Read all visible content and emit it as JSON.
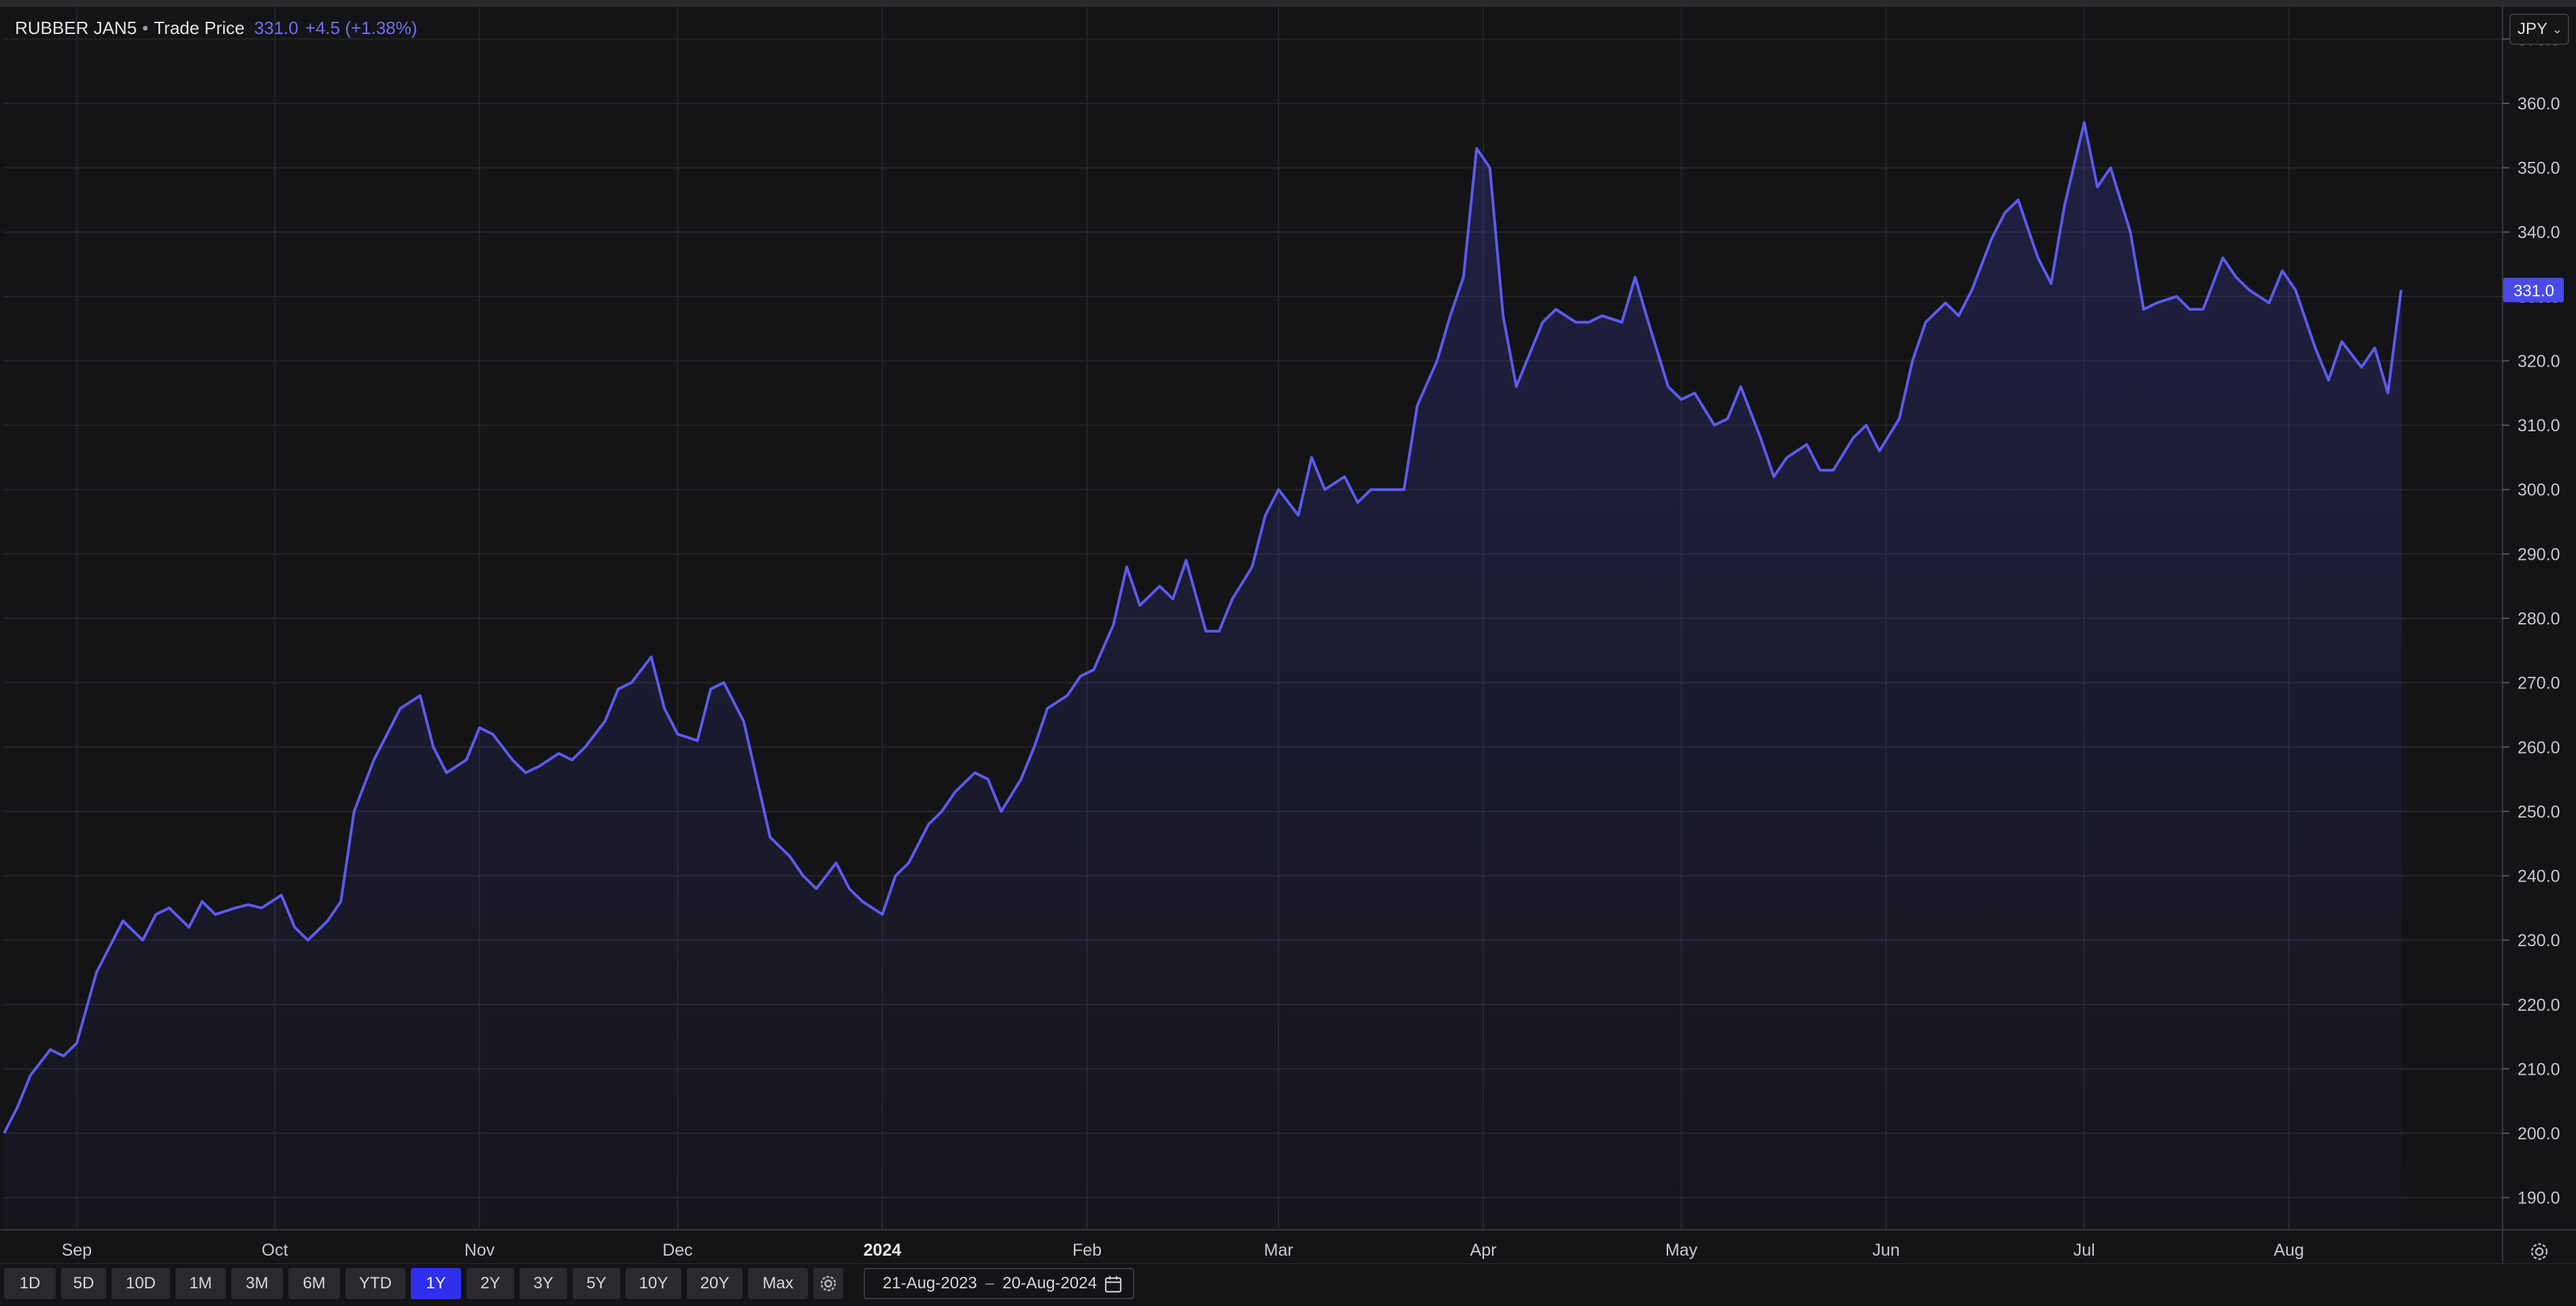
{
  "legend": {
    "symbol": "RUBBER JAN5",
    "separator": "•",
    "series_label": "Trade Price",
    "last_value": "331.0",
    "change": "+4.5 (+1.38%)"
  },
  "currency": {
    "label": "JPY",
    "chevron_icon": "chevron-down-icon"
  },
  "price_tag": "331.0",
  "toolbar": {
    "ranges": [
      "1D",
      "5D",
      "10D",
      "1M",
      "3M",
      "6M",
      "YTD",
      "1Y",
      "2Y",
      "3Y",
      "5Y",
      "10Y",
      "20Y",
      "Max"
    ],
    "active_range": "1Y",
    "settings_icon": "gear-icon",
    "date_from": "21-Aug-2023",
    "date_sep": "–",
    "date_to": "20-Aug-2024",
    "calendar_icon": "calendar-icon"
  },
  "corner_icon": "gear-icon",
  "colors": {
    "line": "#5b5bf0",
    "active_button": "#2f2ff0",
    "background": "#141416",
    "grid": "#242428"
  },
  "chart_data": {
    "type": "area",
    "title": "",
    "xlabel": "",
    "ylabel": "",
    "ylim": [
      185,
      375
    ],
    "y_ticks": [
      "190.0",
      "200.0",
      "210.0",
      "220.0",
      "230.0",
      "240.0",
      "250.0",
      "260.0",
      "270.0",
      "280.0",
      "290.0",
      "300.0",
      "310.0",
      "320.0",
      "330.0",
      "340.0",
      "350.0",
      "360.0",
      "370.0"
    ],
    "x_ticks": [
      {
        "label": "Sep",
        "date": "2023-09-01",
        "bold": false
      },
      {
        "label": "Oct",
        "date": "2023-10-01",
        "bold": false
      },
      {
        "label": "Nov",
        "date": "2023-11-01",
        "bold": false
      },
      {
        "label": "Dec",
        "date": "2023-12-01",
        "bold": false
      },
      {
        "label": "2024",
        "date": "2024-01-01",
        "bold": true
      },
      {
        "label": "Feb",
        "date": "2024-02-01",
        "bold": false
      },
      {
        "label": "Mar",
        "date": "2024-03-01",
        "bold": false
      },
      {
        "label": "Apr",
        "date": "2024-04-01",
        "bold": false
      },
      {
        "label": "May",
        "date": "2024-05-01",
        "bold": false
      },
      {
        "label": "Jun",
        "date": "2024-06-01",
        "bold": false
      },
      {
        "label": "Jul",
        "date": "2024-07-01",
        "bold": false
      },
      {
        "label": "Aug",
        "date": "2024-08-01",
        "bold": false
      }
    ],
    "grid": true,
    "series": [
      {
        "points": [
          [
            "2023-08-21",
            200.0
          ],
          [
            "2023-08-23",
            204.0
          ],
          [
            "2023-08-25",
            209.0
          ],
          [
            "2023-08-28",
            213.0
          ],
          [
            "2023-08-30",
            212.0
          ],
          [
            "2023-09-01",
            214.0
          ],
          [
            "2023-09-04",
            225.0
          ],
          [
            "2023-09-06",
            229.0
          ],
          [
            "2023-09-08",
            233.0
          ],
          [
            "2023-09-11",
            230.0
          ],
          [
            "2023-09-13",
            234.0
          ],
          [
            "2023-09-15",
            235.0
          ],
          [
            "2023-09-18",
            232.0
          ],
          [
            "2023-09-20",
            236.0
          ],
          [
            "2023-09-22",
            234.0
          ],
          [
            "2023-09-25",
            235.0
          ],
          [
            "2023-09-27",
            235.5
          ],
          [
            "2023-09-29",
            235.0
          ],
          [
            "2023-10-02",
            237.0
          ],
          [
            "2023-10-04",
            232.0
          ],
          [
            "2023-10-06",
            230.0
          ],
          [
            "2023-10-09",
            233.0
          ],
          [
            "2023-10-11",
            236.0
          ],
          [
            "2023-10-13",
            250.0
          ],
          [
            "2023-10-16",
            258.0
          ],
          [
            "2023-10-18",
            262.0
          ],
          [
            "2023-10-20",
            266.0
          ],
          [
            "2023-10-23",
            268.0
          ],
          [
            "2023-10-25",
            260.0
          ],
          [
            "2023-10-27",
            256.0
          ],
          [
            "2023-10-30",
            258.0
          ],
          [
            "2023-11-01",
            263.0
          ],
          [
            "2023-11-03",
            262.0
          ],
          [
            "2023-11-06",
            258.0
          ],
          [
            "2023-11-08",
            256.0
          ],
          [
            "2023-11-10",
            257.0
          ],
          [
            "2023-11-13",
            259.0
          ],
          [
            "2023-11-15",
            258.0
          ],
          [
            "2023-11-17",
            260.0
          ],
          [
            "2023-11-20",
            264.0
          ],
          [
            "2023-11-22",
            269.0
          ],
          [
            "2023-11-24",
            270.0
          ],
          [
            "2023-11-27",
            274.0
          ],
          [
            "2023-11-29",
            266.0
          ],
          [
            "2023-12-01",
            262.0
          ],
          [
            "2023-12-04",
            261.0
          ],
          [
            "2023-12-06",
            269.0
          ],
          [
            "2023-12-08",
            270.0
          ],
          [
            "2023-12-11",
            264.0
          ],
          [
            "2023-12-13",
            255.0
          ],
          [
            "2023-12-15",
            246.0
          ],
          [
            "2023-12-18",
            243.0
          ],
          [
            "2023-12-20",
            240.0
          ],
          [
            "2023-12-22",
            238.0
          ],
          [
            "2023-12-25",
            242.0
          ],
          [
            "2023-12-27",
            238.0
          ],
          [
            "2023-12-29",
            236.0
          ],
          [
            "2024-01-01",
            234.0
          ],
          [
            "2024-01-03",
            240.0
          ],
          [
            "2024-01-05",
            242.0
          ],
          [
            "2024-01-08",
            248.0
          ],
          [
            "2024-01-10",
            250.0
          ],
          [
            "2024-01-12",
            253.0
          ],
          [
            "2024-01-15",
            256.0
          ],
          [
            "2024-01-17",
            255.0
          ],
          [
            "2024-01-19",
            250.0
          ],
          [
            "2024-01-22",
            255.0
          ],
          [
            "2024-01-24",
            260.0
          ],
          [
            "2024-01-26",
            266.0
          ],
          [
            "2024-01-29",
            268.0
          ],
          [
            "2024-01-31",
            271.0
          ],
          [
            "2024-02-02",
            272.0
          ],
          [
            "2024-02-05",
            279.0
          ],
          [
            "2024-02-07",
            288.0
          ],
          [
            "2024-02-09",
            282.0
          ],
          [
            "2024-02-12",
            285.0
          ],
          [
            "2024-02-14",
            283.0
          ],
          [
            "2024-02-16",
            289.0
          ],
          [
            "2024-02-19",
            278.0
          ],
          [
            "2024-02-21",
            278.0
          ],
          [
            "2024-02-23",
            283.0
          ],
          [
            "2024-02-26",
            288.0
          ],
          [
            "2024-02-28",
            296.0
          ],
          [
            "2024-03-01",
            300.0
          ],
          [
            "2024-03-04",
            296.0
          ],
          [
            "2024-03-06",
            305.0
          ],
          [
            "2024-03-08",
            300.0
          ],
          [
            "2024-03-11",
            302.0
          ],
          [
            "2024-03-13",
            298.0
          ],
          [
            "2024-03-15",
            300.0
          ],
          [
            "2024-03-18",
            300.0
          ],
          [
            "2024-03-20",
            300.0
          ],
          [
            "2024-03-22",
            313.0
          ],
          [
            "2024-03-25",
            320.0
          ],
          [
            "2024-03-27",
            327.0
          ],
          [
            "2024-03-29",
            333.0
          ],
          [
            "2024-03-31",
            353.0
          ],
          [
            "2024-04-02",
            350.0
          ],
          [
            "2024-04-04",
            327.0
          ],
          [
            "2024-04-06",
            316.0
          ],
          [
            "2024-04-08",
            321.0
          ],
          [
            "2024-04-10",
            326.0
          ],
          [
            "2024-04-12",
            328.0
          ],
          [
            "2024-04-15",
            326.0
          ],
          [
            "2024-04-17",
            326.0
          ],
          [
            "2024-04-19",
            327.0
          ],
          [
            "2024-04-22",
            326.0
          ],
          [
            "2024-04-24",
            333.0
          ],
          [
            "2024-04-26",
            326.0
          ],
          [
            "2024-04-29",
            316.0
          ],
          [
            "2024-05-01",
            314.0
          ],
          [
            "2024-05-03",
            315.0
          ],
          [
            "2024-05-06",
            310.0
          ],
          [
            "2024-05-08",
            311.0
          ],
          [
            "2024-05-10",
            316.0
          ],
          [
            "2024-05-13",
            308.0
          ],
          [
            "2024-05-15",
            302.0
          ],
          [
            "2024-05-17",
            305.0
          ],
          [
            "2024-05-20",
            307.0
          ],
          [
            "2024-05-22",
            303.0
          ],
          [
            "2024-05-24",
            303.0
          ],
          [
            "2024-05-27",
            308.0
          ],
          [
            "2024-05-29",
            310.0
          ],
          [
            "2024-05-31",
            306.0
          ],
          [
            "2024-06-03",
            311.0
          ],
          [
            "2024-06-05",
            320.0
          ],
          [
            "2024-06-07",
            326.0
          ],
          [
            "2024-06-10",
            329.0
          ],
          [
            "2024-06-12",
            327.0
          ],
          [
            "2024-06-14",
            331.0
          ],
          [
            "2024-06-17",
            339.0
          ],
          [
            "2024-06-19",
            343.0
          ],
          [
            "2024-06-21",
            345.0
          ],
          [
            "2024-06-24",
            336.0
          ],
          [
            "2024-06-26",
            332.0
          ],
          [
            "2024-06-28",
            344.0
          ],
          [
            "2024-07-01",
            357.0
          ],
          [
            "2024-07-03",
            347.0
          ],
          [
            "2024-07-05",
            350.0
          ],
          [
            "2024-07-08",
            340.0
          ],
          [
            "2024-07-10",
            328.0
          ],
          [
            "2024-07-12",
            329.0
          ],
          [
            "2024-07-15",
            330.0
          ],
          [
            "2024-07-17",
            328.0
          ],
          [
            "2024-07-19",
            328.0
          ],
          [
            "2024-07-22",
            336.0
          ],
          [
            "2024-07-24",
            333.0
          ],
          [
            "2024-07-26",
            331.0
          ],
          [
            "2024-07-29",
            329.0
          ],
          [
            "2024-07-31",
            334.0
          ],
          [
            "2024-08-02",
            331.0
          ],
          [
            "2024-08-05",
            322.0
          ],
          [
            "2024-08-07",
            317.0
          ],
          [
            "2024-08-09",
            323.0
          ],
          [
            "2024-08-12",
            319.0
          ],
          [
            "2024-08-14",
            322.0
          ],
          [
            "2024-08-16",
            315.0
          ],
          [
            "2024-08-18",
            331.0
          ]
        ]
      }
    ]
  }
}
